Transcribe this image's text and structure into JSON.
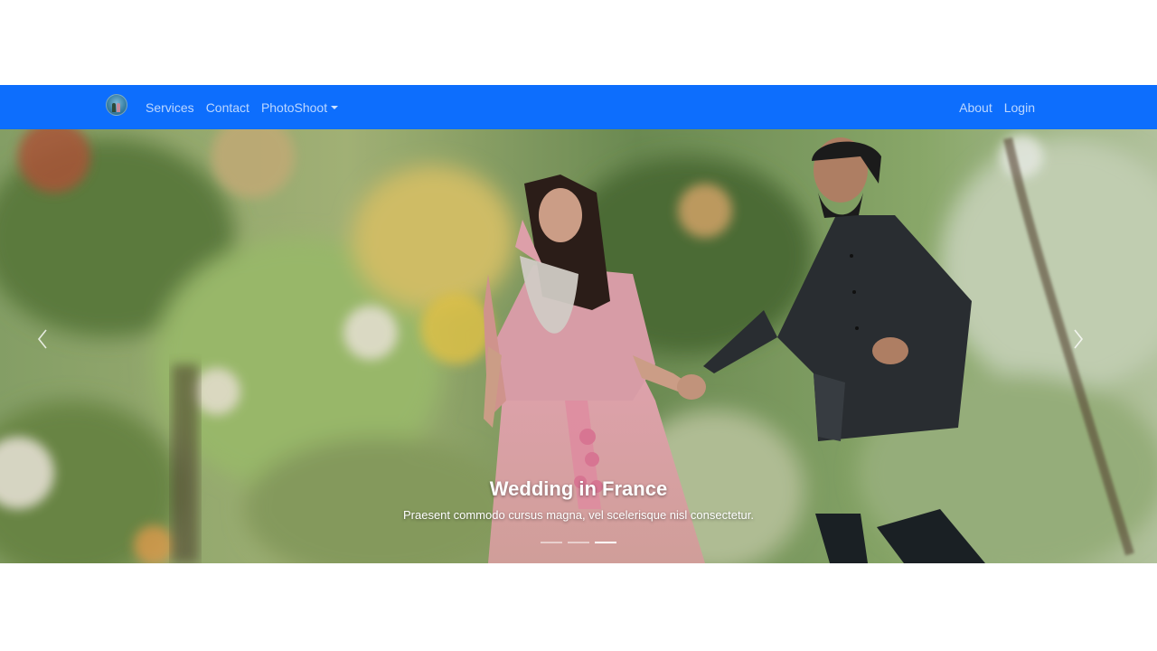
{
  "navbar": {
    "brand_logo": "couple-logo-icon",
    "left_links": [
      {
        "label": "Services"
      },
      {
        "label": "Contact"
      },
      {
        "label": "PhotoShoot"
      }
    ],
    "right_links": [
      {
        "label": "About"
      },
      {
        "label": "Login"
      }
    ],
    "background_color": "#0d6efd"
  },
  "carousel": {
    "caption_title": "Wedding in France",
    "caption_text": "Praesent commodo cursus magna, vel scelerisque nisl consectetur.",
    "prev_icon": "chevron-left-icon",
    "next_icon": "chevron-right-icon",
    "slide_count": 3,
    "active_slide": 3
  }
}
